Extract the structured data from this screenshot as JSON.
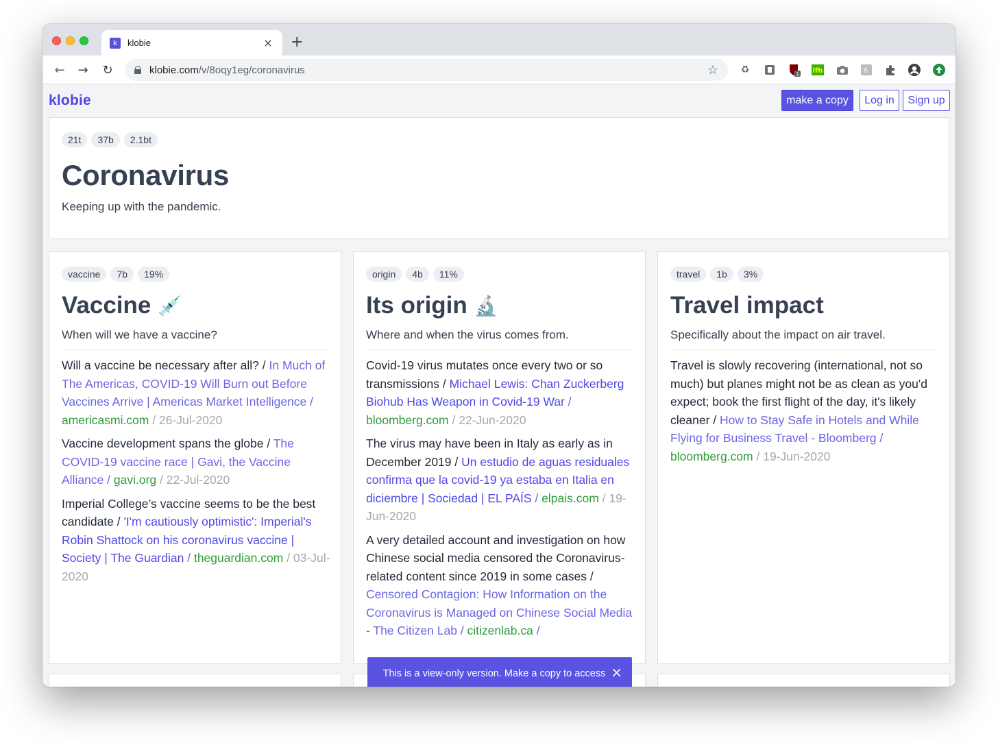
{
  "browser": {
    "tab_title": "klobie",
    "tab_favicon": "k",
    "new_tab_icon": "+",
    "close_icon": "×",
    "url_host": "klobie.com",
    "url_path": "/v/8oqy1eg/coronavirus"
  },
  "nav": {
    "brand": "klobie",
    "make_copy": "make a copy",
    "log_in": "Log in",
    "sign_up": "Sign up"
  },
  "header": {
    "badges": [
      "21t",
      "37b",
      "2.1bt"
    ],
    "title": "Coronavirus",
    "description": "Keeping up with the pandemic."
  },
  "topics": [
    {
      "badges": [
        "vaccine",
        "7b",
        "19%"
      ],
      "title": "Vaccine",
      "emoji": "💉",
      "description": "When will we have a vaccine?",
      "entries": [
        {
          "text": "Will a vaccine be necessary after all? / ",
          "link": "In Much of The Americas, COVID-19 Will Burn out Before Vaccines Arrive | Americas Market Intelligence",
          "domain": "americasmi.com",
          "date": "26-Jul-2020"
        },
        {
          "text": "Vaccine development spans the globe / ",
          "link": "The COVID-19 vaccine race | Gavi, the Vaccine Alliance",
          "domain": "gavi.org",
          "date": "22-Jul-2020"
        },
        {
          "text": "Imperial College’s vaccine seems to be the best candidate / ",
          "link": "'I'm cautiously optimistic': Imperial's Robin Shattock on his coronavirus vaccine | Society | The Guardian",
          "domain": "theguardian.com",
          "date": "03-Jul-2020"
        }
      ]
    },
    {
      "badges": [
        "origin",
        "4b",
        "11%"
      ],
      "title": "Its origin",
      "emoji": "🔬",
      "description": "Where and when the virus comes from.",
      "entries": [
        {
          "text": "Covid-19 virus mutates once every two or so transmissions / ",
          "link": "Michael Lewis: Chan Zuckerberg Biohub Has Weapon in Covid-19 War",
          "domain": "bloomberg.com",
          "date": "22-Jun-2020"
        },
        {
          "text": "The virus may have been in Italy as early as in December 2019 / ",
          "link": "Un estudio de aguas residuales confirma que la covid-19 ya estaba en Italia en diciembre | Sociedad | EL PAÍS",
          "domain": "elpais.com",
          "date": "19-Jun-2020"
        },
        {
          "text": "A very detailed account and investigation on how Chinese social media censored the Coronavirus-related content since 2019 in some cases / ",
          "link": "Censored Contagion: How Information on the Coronavirus is Managed on Chinese Social Media - The Citizen Lab",
          "domain": "citizenlab.ca",
          "date": ""
        }
      ]
    },
    {
      "badges": [
        "travel",
        "1b",
        "3%"
      ],
      "title": "Travel impact",
      "emoji": "",
      "description": "Specifically about the impact on air travel.",
      "entries": [
        {
          "text": "Travel is slowly recovering (international, not so much) but planes might not be as clean as you'd expect; book the first flight of the day, it's likely cleaner / ",
          "link": "How to Stay Safe in Hotels and While Flying for Business Travel - Bloomberg",
          "domain": "bloomberg.com",
          "date": "19-Jun-2020"
        }
      ]
    }
  ],
  "toast": {
    "message": "This is a view-only version. Make a copy to access features and edit."
  },
  "colors": {
    "accent": "#5a52e0",
    "link": "#6b66e3",
    "domain": "#2e9d3a",
    "date": "#a3a8b0"
  }
}
